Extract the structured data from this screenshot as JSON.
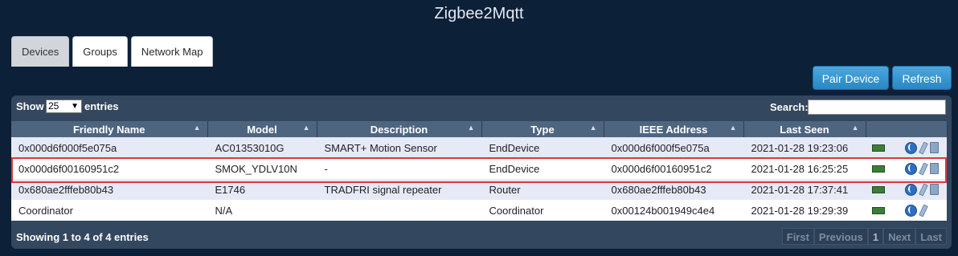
{
  "app": {
    "title": "Zigbee2Mqtt"
  },
  "tabs": [
    {
      "label": "Devices",
      "active": true
    },
    {
      "label": "Groups",
      "active": false
    },
    {
      "label": "Network Map",
      "active": false
    }
  ],
  "actions": {
    "pair_label": "Pair Device",
    "refresh_label": "Refresh"
  },
  "toolbar": {
    "show_label": "Show",
    "entries_selected": "25",
    "entries_label": "entries",
    "search_label": "Search:",
    "search_value": ""
  },
  "columns": [
    "Friendly Name",
    "Model",
    "Description",
    "Type",
    "IEEE Address",
    "Last Seen"
  ],
  "rows": [
    {
      "friendly_name": "0x000d6f000f5e075a",
      "model": "AC01353010G",
      "description": "SMART+ Motion Sensor",
      "type": "EndDevice",
      "ieee": "0x000d6f000f5e075a",
      "last_seen": "2021-01-28 19:23:06",
      "deletable": true
    },
    {
      "friendly_name": "0x000d6f00160951c2",
      "model": "SMOK_YDLV10N",
      "description": "-",
      "type": "EndDevice",
      "ieee": "0x000d6f00160951c2",
      "last_seen": "2021-01-28 16:25:25",
      "deletable": true
    },
    {
      "friendly_name": "0x680ae2fffeb80b43",
      "model": "E1746",
      "description": "TRADFRI signal repeater",
      "type": "Router",
      "ieee": "0x680ae2fffeb80b43",
      "last_seen": "2021-01-28 17:37:41",
      "deletable": true
    },
    {
      "friendly_name": "Coordinator",
      "model": "N/A",
      "description": "",
      "type": "Coordinator",
      "ieee": "0x00124b001949c4e4",
      "last_seen": "2021-01-28 19:29:39",
      "deletable": false
    }
  ],
  "footer": {
    "info": "Showing 1 to 4 of 4 entries",
    "pager": {
      "first": "First",
      "previous": "Previous",
      "page": "1",
      "next": "Next",
      "last": "Last"
    }
  },
  "icons": {
    "device": "device-image-icon",
    "globe": "globe-icon",
    "rename": "pencil-icon",
    "remove": "trash-icon"
  },
  "colors": {
    "accent": "#2b86c2",
    "highlight": "#e03838"
  }
}
